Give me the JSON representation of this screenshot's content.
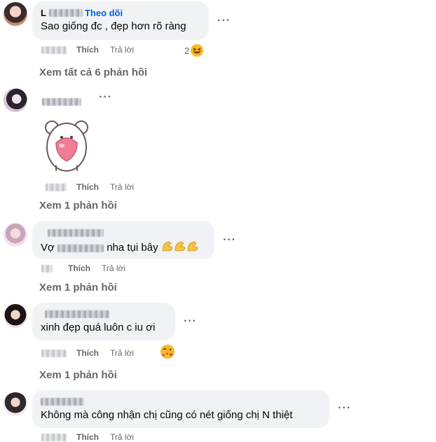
{
  "comments": [
    {
      "name_visible": "L",
      "follow_label": "Theo dõi",
      "text": "Sao giống đc , đẹp hơn rõ ràng",
      "like": "Thích",
      "reply": "Trả lời",
      "reaction_count": "2"
    },
    {
      "like": "Thích",
      "reply": "Trả lời"
    },
    {
      "text_before": "Vợ",
      "text_after": "nha tụi bây",
      "like": "Thích",
      "reply": "Trả lời"
    },
    {
      "text": "xinh đẹp quá luôn c iu ơi",
      "like": "Thích",
      "reply": "Trả lời"
    },
    {
      "text": "Không mà công nhận chị cũng có nét giống chị N thiệt",
      "like": "Thích",
      "reply": "Trả lời"
    }
  ],
  "view_replies": [
    "Xem tất cả 6 phản hồi",
    "Xem 1 phản hồi",
    "Xem 1 phản hồi",
    "Xem 1 phản hồi"
  ],
  "more_label": "···",
  "icons": {
    "laugh": "laughing-face-emoji",
    "flex": "flexed-biceps-emoji",
    "kiss": "face-blowing-kiss-emoji",
    "sticker": "bear-holding-heart-sticker"
  }
}
